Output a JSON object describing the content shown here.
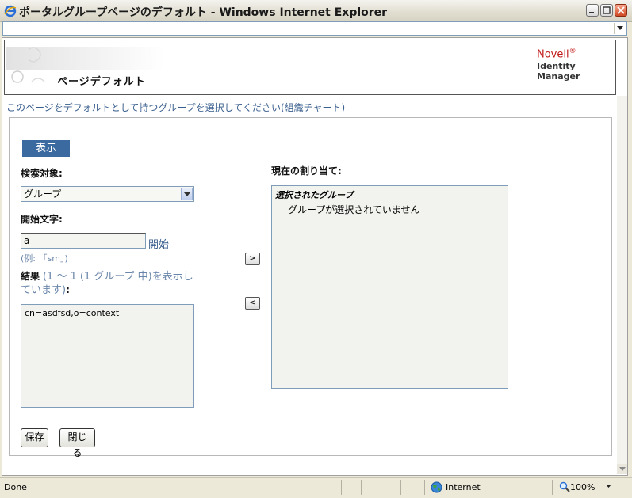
{
  "window": {
    "title": "ポータルグループページのデフォルト",
    "app_suffix": " - Windows Internet Explorer"
  },
  "header": {
    "title": "ページデフォルト",
    "brand_novell": "Novell",
    "brand_reg": "®",
    "brand_product": "Identity Manager"
  },
  "instruction": "このページをデフォルトとして持つグループを選択してください(組織チャート)",
  "tab": {
    "label": "表示"
  },
  "search": {
    "target_label": "検索対象:",
    "target_value": "グループ",
    "start_label": "開始文字:",
    "start_value": "a",
    "start_link": "開始",
    "hint": "(例: 「sm」)"
  },
  "results": {
    "label": "結果",
    "note": "(1 〜 1 (1 グループ 中)を表示しています)",
    "colon": ":",
    "items": [
      "cn=asdfsd,o=context"
    ]
  },
  "assigned": {
    "label": "現在の割り当て:",
    "header": "選択されたグループ",
    "empty_text": "グループが選択されていません"
  },
  "buttons": {
    "add": ">",
    "remove": "<",
    "save": "保存",
    "close": "閉じる"
  },
  "statusbar": {
    "status": "Done",
    "zone": "Internet",
    "zoom": "100%"
  },
  "icons": [
    "ie-icon",
    "minimize-icon",
    "maximize-icon",
    "close-icon",
    "chevron-down-icon",
    "globe-icon",
    "zoom-icon"
  ],
  "colors": {
    "accent": "#3a6aa0",
    "link": "#3a5f8f",
    "brand": "#c01818"
  }
}
